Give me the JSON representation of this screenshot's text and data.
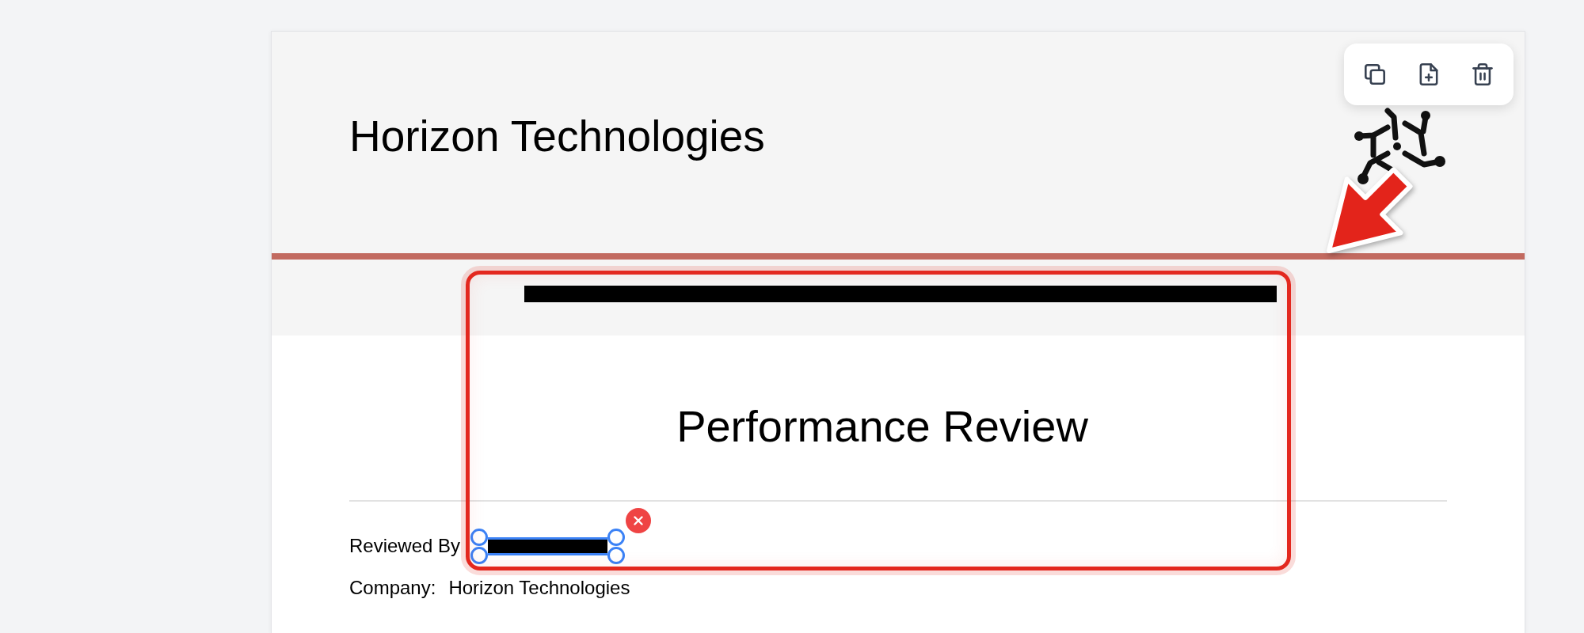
{
  "document": {
    "header": {
      "title": "Horizon Technologies",
      "subtitle": {
        "redacted": true
      }
    },
    "title": "Performance Review",
    "fields": [
      {
        "label": "Reviewed By",
        "redacted": true,
        "selected": true
      },
      {
        "label": "Company:",
        "value": "Horizon Technologies",
        "redacted": false,
        "selected": false
      }
    ]
  },
  "toolbar": {
    "buttons": [
      {
        "kind": "copy"
      },
      {
        "kind": "add-page"
      },
      {
        "kind": "delete"
      }
    ]
  },
  "annotations": [
    {
      "kind": "box"
    },
    {
      "kind": "arrow"
    }
  ]
}
